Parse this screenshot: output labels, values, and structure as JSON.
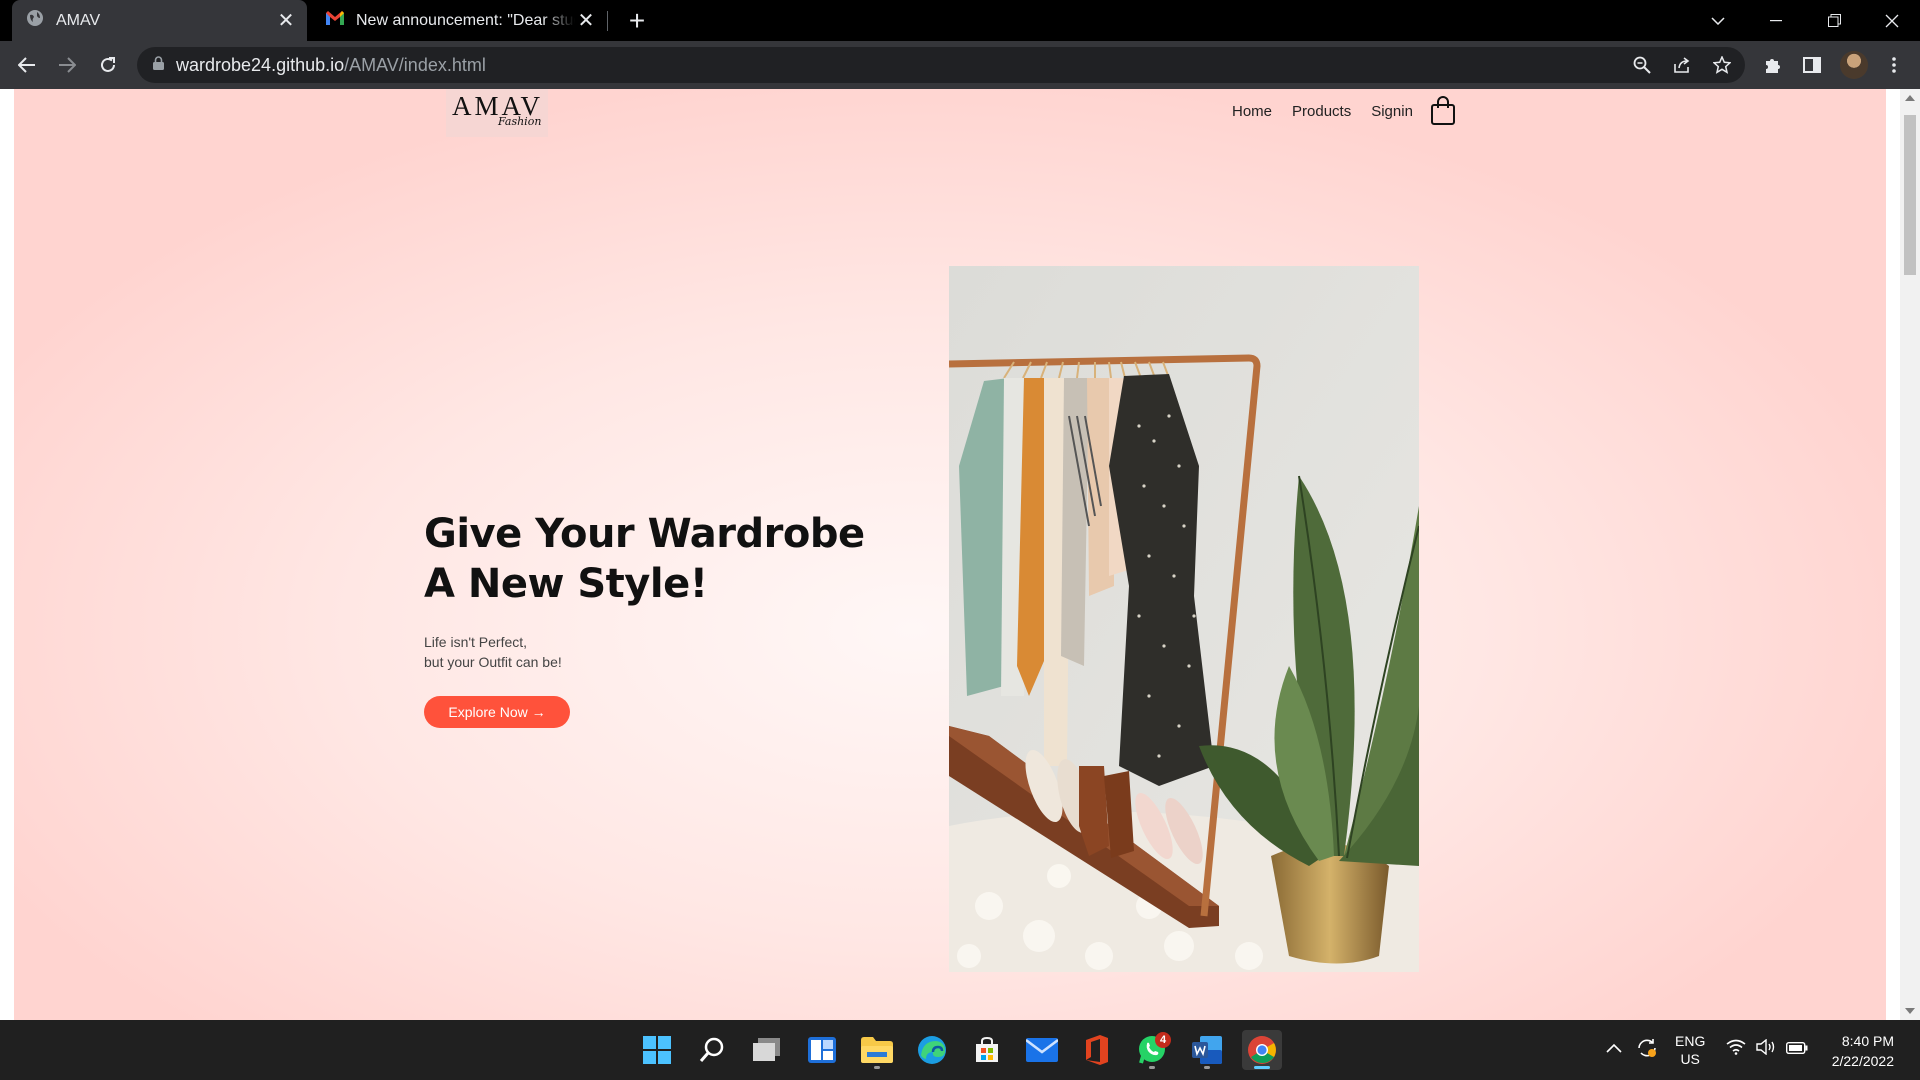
{
  "browser": {
    "tabs": [
      {
        "title": "AMAV",
        "icon": "globe-icon",
        "active": true
      },
      {
        "title": "New announcement: \"Dear stude",
        "icon": "gmail-icon",
        "active": false
      }
    ],
    "url_host": "wardrobe24.github.io",
    "url_path": "/AMAV/index.html"
  },
  "site": {
    "logo": {
      "main": "AMAV",
      "sub": "Fashion"
    },
    "nav": [
      "Home",
      "Products",
      "Signin"
    ],
    "hero": {
      "title_line1": "Give Your Wardrobe",
      "title_line2": "A New Style!",
      "subtitle_line1": "Life isn't Perfect,",
      "subtitle_line2": "but your Outfit can be!",
      "button": "Explore Now →"
    },
    "colors": {
      "accent": "#ff523b",
      "background": "#ffe7e4"
    }
  },
  "taskbar": {
    "apps": [
      "start-icon",
      "search-icon",
      "task-view-icon",
      "widgets-icon",
      "file-explorer-icon",
      "edge-icon",
      "store-icon",
      "mail-icon",
      "office-icon",
      "whatsapp-icon",
      "word-icon",
      "chrome-icon"
    ],
    "whatsapp_badge": "4",
    "lang_line1": "ENG",
    "lang_line2": "US",
    "time": "8:40 PM",
    "date": "2/22/2022"
  }
}
